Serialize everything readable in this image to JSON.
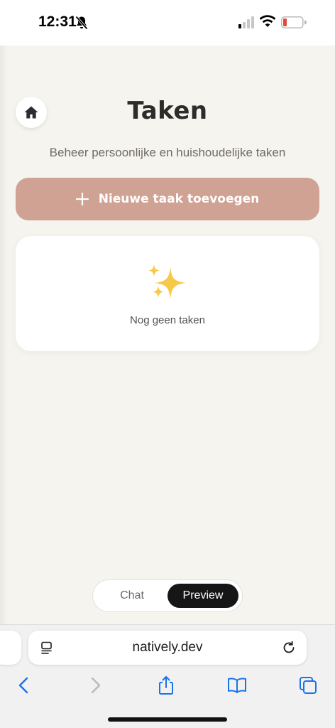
{
  "status_bar": {
    "time": "12:31",
    "icons": [
      "bell-slash-icon",
      "signal-icon",
      "wifi-icon",
      "battery-low-icon"
    ],
    "battery_color": "#e5483c"
  },
  "app": {
    "title": "Taken",
    "subtitle": "Beheer persoonlijke en huishoudelijke taken",
    "add_task_label": "Nieuwe taak toevoegen",
    "empty_state_text": "Nog geen taken",
    "empty_state_icon": "sparkles-icon",
    "home_icon": "home-icon",
    "colors": {
      "background": "#f6f4ef",
      "accent_button": "#cfa294",
      "title": "#2e2c2a"
    }
  },
  "view_toggle": {
    "options": [
      "Chat",
      "Preview"
    ],
    "selected": "Preview"
  },
  "browser": {
    "url": "natively.dev",
    "toolbar_icons": [
      "back-icon",
      "forward-icon",
      "share-icon",
      "bookmarks-icon",
      "tabs-icon"
    ],
    "accent": "#1a73e8"
  }
}
